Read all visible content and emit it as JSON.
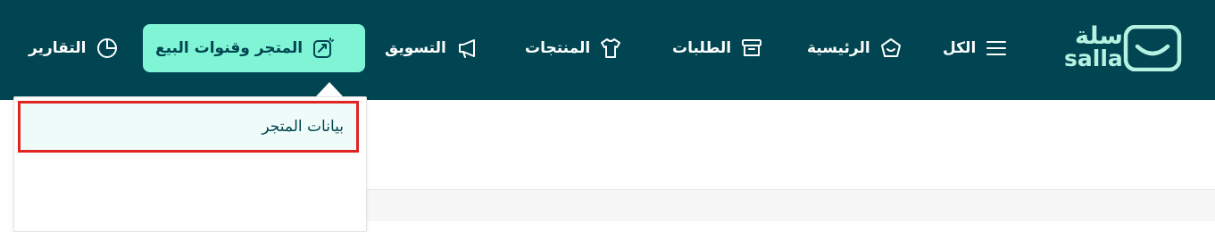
{
  "brand": {
    "logo_ar": "سلة",
    "logo_en": "salla",
    "colors": {
      "header_bg": "#004551",
      "accent": "#7ff5d6",
      "logo": "#b6f2e1",
      "highlight_border": "#e02424"
    }
  },
  "nav": {
    "items": [
      {
        "label": "الكل",
        "icon": "menu-icon"
      },
      {
        "label": "الرئيسية",
        "icon": "home-icon"
      },
      {
        "label": "الطلبات",
        "icon": "orders-box-icon"
      },
      {
        "label": "المنتجات",
        "icon": "tshirt-icon"
      },
      {
        "label": "التسويق",
        "icon": "megaphone-icon"
      },
      {
        "label": "المتجر وقنوات البيع",
        "icon": "store-channels-icon",
        "active": true
      },
      {
        "label": "التقارير",
        "icon": "pie-chart-icon"
      }
    ]
  },
  "dropdown": {
    "items": [
      {
        "label": "بيانات المتجر",
        "highlighted": true
      }
    ]
  }
}
